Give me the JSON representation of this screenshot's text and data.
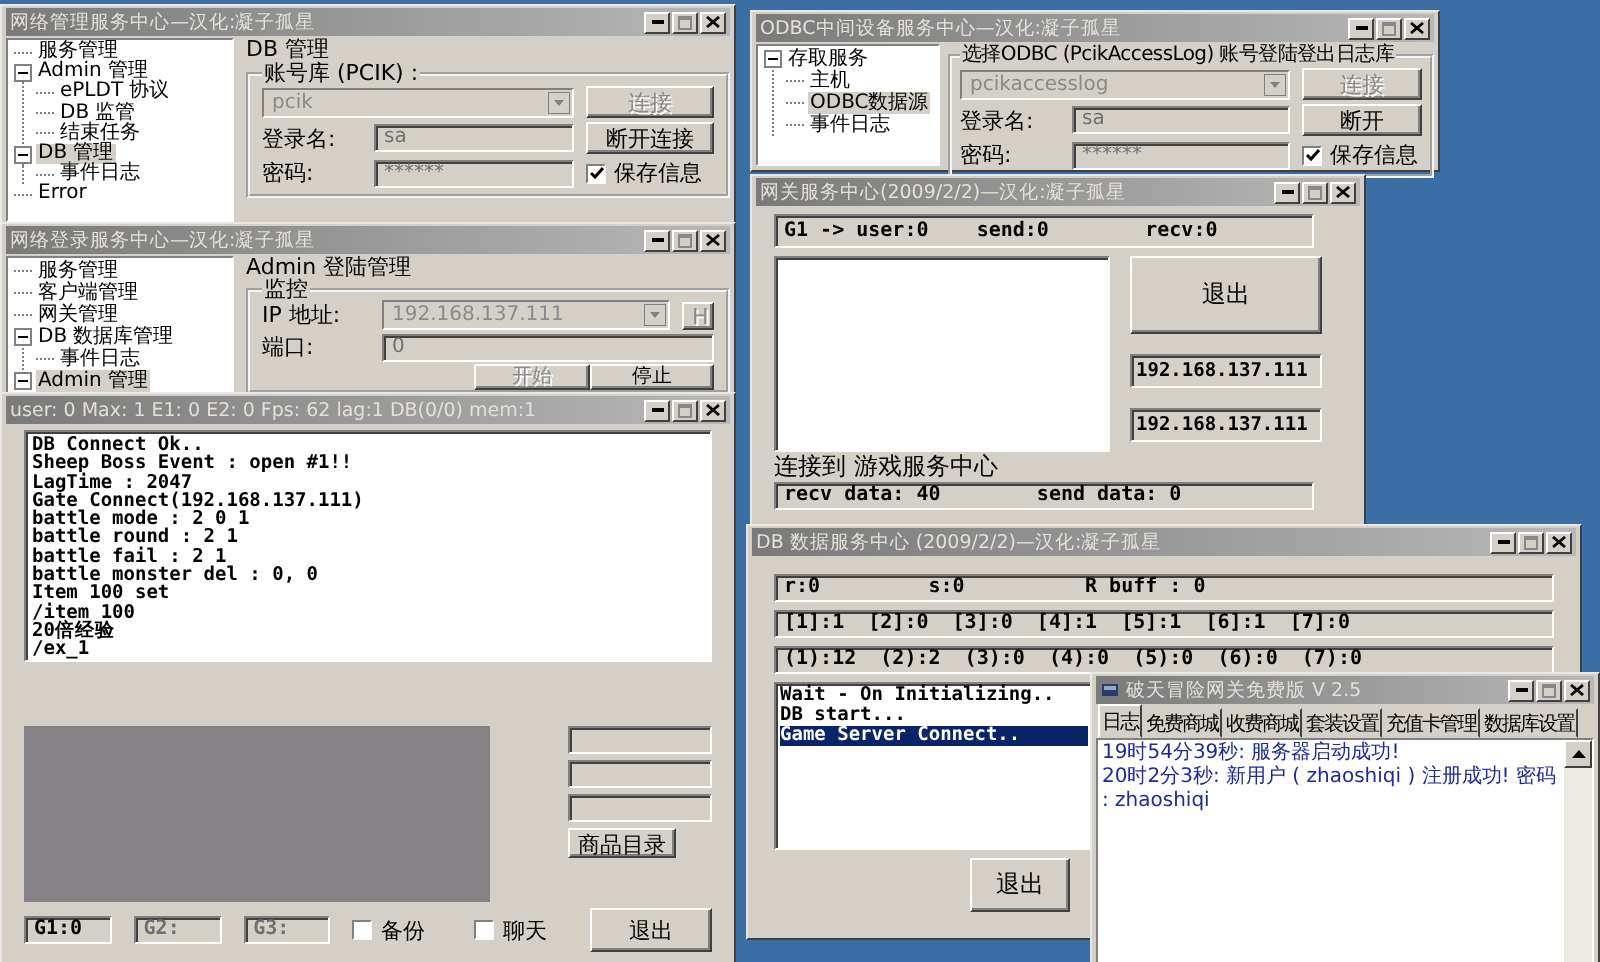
{
  "admin_window": {
    "title": "网络管理服务中心—汉化:凝子孤星",
    "tree": [
      {
        "label": "服务管理",
        "selected": false
      },
      {
        "label": "Admin 管理",
        "selected": false,
        "expanded": true,
        "children": [
          {
            "label": "ePLDT 协议",
            "selected": false
          },
          {
            "label": "DB 监管",
            "selected": false
          },
          {
            "label": "结束任务",
            "selected": false
          }
        ]
      },
      {
        "label": "DB 管理",
        "selected": true,
        "expanded": true,
        "children": [
          {
            "label": "事件日志",
            "selected": false
          }
        ]
      },
      {
        "label": "Error",
        "selected": false
      }
    ],
    "panel_title": "DB 管理",
    "group_label": "账号库 (PCIK) :",
    "database": {
      "value": "pcik",
      "disabled": true
    },
    "login_label": "登录名:",
    "login": {
      "value": "sa",
      "disabled": true
    },
    "password_label": "密码:",
    "password": {
      "value": "******",
      "disabled": true
    },
    "buttons": [
      {
        "label": "连接",
        "disabled": true
      },
      {
        "label": "断开连接",
        "disabled": false
      }
    ],
    "save_info": {
      "label": "保存信息",
      "checked": true
    }
  },
  "login_window": {
    "title": "网络登录服务中心—汉化:凝子孤星",
    "tree": [
      {
        "label": "服务管理",
        "selected": false
      },
      {
        "label": "客户端管理",
        "selected": false
      },
      {
        "label": "网关管理",
        "selected": false
      },
      {
        "label": "DB 数据库管理",
        "selected": false,
        "expanded": true,
        "children": [
          {
            "label": "事件日志",
            "selected": false
          }
        ]
      },
      {
        "label": "Admin 管理",
        "selected": true,
        "expanded": true
      }
    ],
    "panel_title": "Admin 登陆管理",
    "group_label": "监控",
    "ip_label": "IP 地址:",
    "ip": {
      "value": "192.168.137.111",
      "disabled": true
    },
    "h_button": {
      "label": "H",
      "disabled": true
    },
    "port_label": "端口:",
    "port": {
      "value": "0",
      "disabled": true
    },
    "buttons": [
      {
        "label": "开始",
        "disabled": true
      },
      {
        "label": "停止",
        "disabled": false
      }
    ]
  },
  "log_window": {
    "title": "user:   0 Max:   1 E1:   0 E2:   0 Fps: 62 lag:1 DB(0/0) mem:1",
    "log": [
      "DB Connect Ok..",
      "Sheep Boss Event : open #1!!",
      "LagTime : 2047",
      "Gate Connect(192.168.137.111)",
      "battle mode : 2 0 1",
      "battle round : 2 1",
      "battle fail : 2 1",
      "battle monster del : 0, 0",
      "Item 100 set",
      "/item 100",
      "20倍经验",
      "/ex_1"
    ],
    "catalog_button": "商品目录",
    "g_fields": [
      {
        "value": "G1:0",
        "disabled": false
      },
      {
        "value": "G2:",
        "disabled": true
      },
      {
        "value": "G3:",
        "disabled": true
      }
    ],
    "checkboxes": [
      {
        "label": "备份",
        "checked": false
      },
      {
        "label": "聊天",
        "checked": false
      }
    ],
    "exit_button": "退出"
  },
  "odbc_window": {
    "title": "ODBC中间设备服务中心—汉化:凝子孤星",
    "tree": [
      {
        "label": "存取服务",
        "selected": false,
        "expanded": true,
        "children": [
          {
            "label": "主机",
            "selected": false
          },
          {
            "label": "ODBC数据源",
            "selected": true
          },
          {
            "label": "事件日志",
            "selected": false
          }
        ]
      }
    ],
    "group_label": "选择ODBC (PcikAccessLog) 账号登陆登出日志库",
    "database": {
      "value": "pcikaccesslog",
      "disabled": true
    },
    "login_label": "登录名:",
    "login": {
      "value": "sa",
      "disabled": true
    },
    "password_label": "密码:",
    "password": {
      "value": "******",
      "disabled": true
    },
    "buttons": [
      {
        "label": "连接",
        "disabled": true
      },
      {
        "label": "断开",
        "disabled": false
      }
    ],
    "save_info": {
      "label": "保存信息",
      "checked": true
    }
  },
  "gateway_window": {
    "title": "网关服务中心(2009/2/2)—汉化:凝子孤星",
    "status": "G1 -> user:0    send:0        recv:0",
    "exit_button": "退出",
    "ips": [
      "192.168.137.111",
      "192.168.137.111"
    ],
    "connect_label": "连接到 游戏服务中心",
    "data": "recv data: 40        send data: 0"
  },
  "db_window": {
    "title": "DB 数据服务中心 (2009/2/2)—汉化:凝子孤星",
    "stats": [
      "r:0         s:0          R buff : 0",
      "[1]:1  [2]:0  [3]:0  [4]:1  [5]:1  [6]:1  [7]:0",
      "(1):12  (2):2  (3):0  (4):0  (5):0  (6):0  (7):0"
    ],
    "log": [
      {
        "text": "Wait - On Initializing..",
        "selected": false
      },
      {
        "text": "DB start...",
        "selected": false
      },
      {
        "text": "Game Server Connect..",
        "selected": true
      }
    ],
    "exit_button": "退出"
  },
  "free_window": {
    "title": "破天冒险网关免费版 V 2.5",
    "tabs": [
      {
        "label": "日志",
        "selected": true
      },
      {
        "label": "免费商城",
        "selected": false
      },
      {
        "label": "收费商城",
        "selected": false
      },
      {
        "label": "套装设置",
        "selected": false
      },
      {
        "label": "充值卡管理",
        "selected": false
      },
      {
        "label": "数据库设置",
        "selected": false
      }
    ],
    "log": [
      "19时54分39秒: 服务器启动成功!",
      "20时2分3秒: 新用户 ( zhaoshiqi ) 注册成功! 密码 : zhaoshiqi"
    ]
  }
}
